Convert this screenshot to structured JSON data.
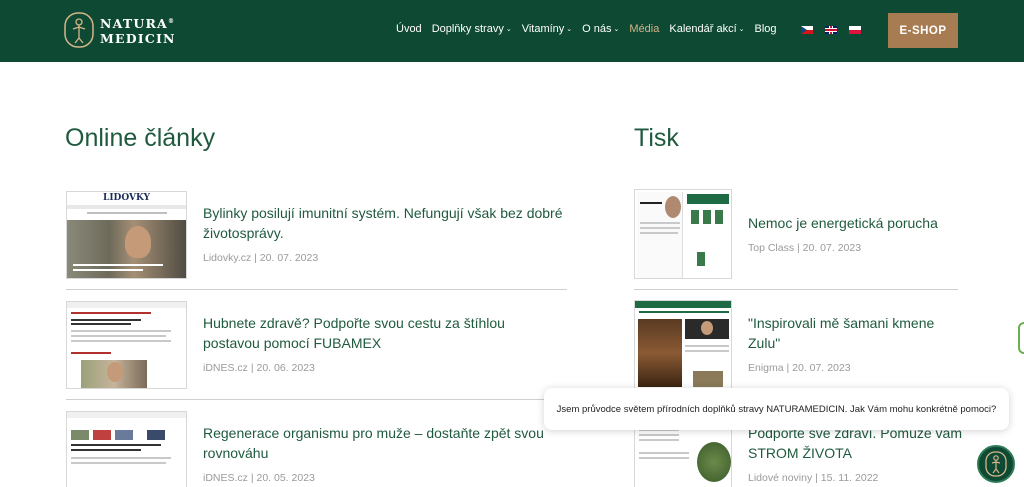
{
  "header": {
    "logo_line1": "NATURA",
    "logo_reg": "®",
    "logo_line2": "MEDICIN",
    "nav": [
      {
        "label": "Úvod",
        "dropdown": false
      },
      {
        "label": "Doplňky stravy",
        "dropdown": true
      },
      {
        "label": "Vitamíny",
        "dropdown": true
      },
      {
        "label": "O nás",
        "dropdown": true
      },
      {
        "label": "Média",
        "dropdown": false,
        "active": true
      },
      {
        "label": "Kalendář akcí",
        "dropdown": true
      },
      {
        "label": "Blog",
        "dropdown": false
      }
    ],
    "chevron": "⌄",
    "languages": [
      "cz-flag",
      "gb-flag",
      "pl-flag"
    ],
    "eshop_label": "E-SHOP"
  },
  "online": {
    "title": "Online články",
    "articles": [
      {
        "title": "Bylinky posilují imunitní systém. Nefungují však bez dobré životosprávy.",
        "meta": "Lidovky.cz | 20. 07. 2023",
        "thumb_brand": "LIDOVKY"
      },
      {
        "title": "Hubnete zdravě? Podpořte svou cestu za štíhlou postavou pomocí FUBAMEX",
        "meta": "iDNES.cz | 20. 06. 2023"
      },
      {
        "title": "Regenerace organismu pro muže – dostaňte zpět svou rovnováhu",
        "meta": "iDNES.cz | 20. 05. 2023"
      }
    ]
  },
  "print": {
    "title": "Tisk",
    "articles": [
      {
        "title": "Nemoc je energetická porucha",
        "meta": "Top Class | 20. 07. 2023"
      },
      {
        "title": "\"Inspirovali mě šamani kmene Zulu\"",
        "meta": "Enigma | 20. 07. 2023"
      },
      {
        "title": "Podpořte své zdraví. Pomůže vám STROM ŽIVOTA",
        "meta": "Lidové noviny | 15. 11. 2022"
      }
    ]
  },
  "chat": {
    "message": "Jsem průvodce světem přírodních doplňků stravy NATURAMEDICIN. Jak Vám mohu konkrétně pomoci?"
  },
  "colors": {
    "header_bg": "#0e4a33",
    "accent_gold": "#a87c53",
    "text_green": "#1f5a3e",
    "meta_gray": "#9a9a9a"
  }
}
